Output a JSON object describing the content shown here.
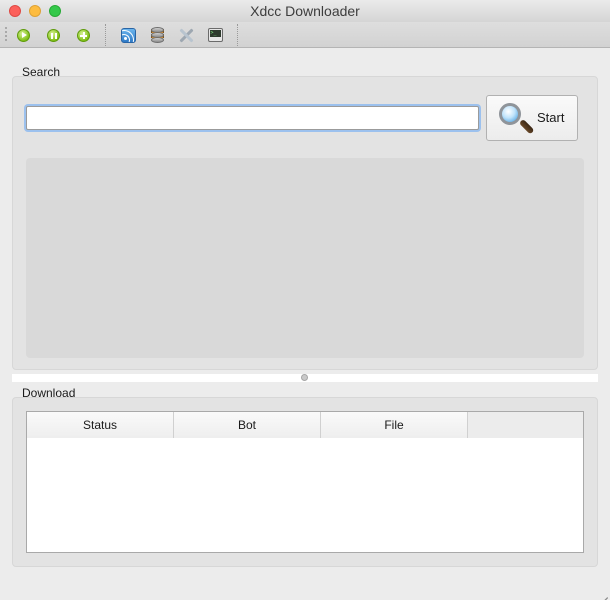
{
  "window": {
    "title": "Xdcc Downloader"
  },
  "toolbar": {
    "buttons": [
      {
        "name": "play",
        "icon": "play-icon"
      },
      {
        "name": "pause",
        "icon": "pause-icon"
      },
      {
        "name": "add",
        "icon": "add-icon"
      },
      {
        "name": "rss",
        "icon": "rss-icon"
      },
      {
        "name": "database",
        "icon": "database-icon"
      },
      {
        "name": "settings",
        "icon": "tools-icon"
      },
      {
        "name": "console",
        "icon": "terminal-icon"
      }
    ]
  },
  "search": {
    "group_label": "Search",
    "input_value": "",
    "start_label": "Start",
    "start_icon": "magnifier-icon"
  },
  "download": {
    "group_label": "Download",
    "columns": [
      "Status",
      "Bot",
      "File"
    ],
    "rows": []
  },
  "colors": {
    "focus_ring": "#9cc1ee",
    "accent_green": "#7fbf16",
    "rss_blue": "#2f7ac6"
  }
}
